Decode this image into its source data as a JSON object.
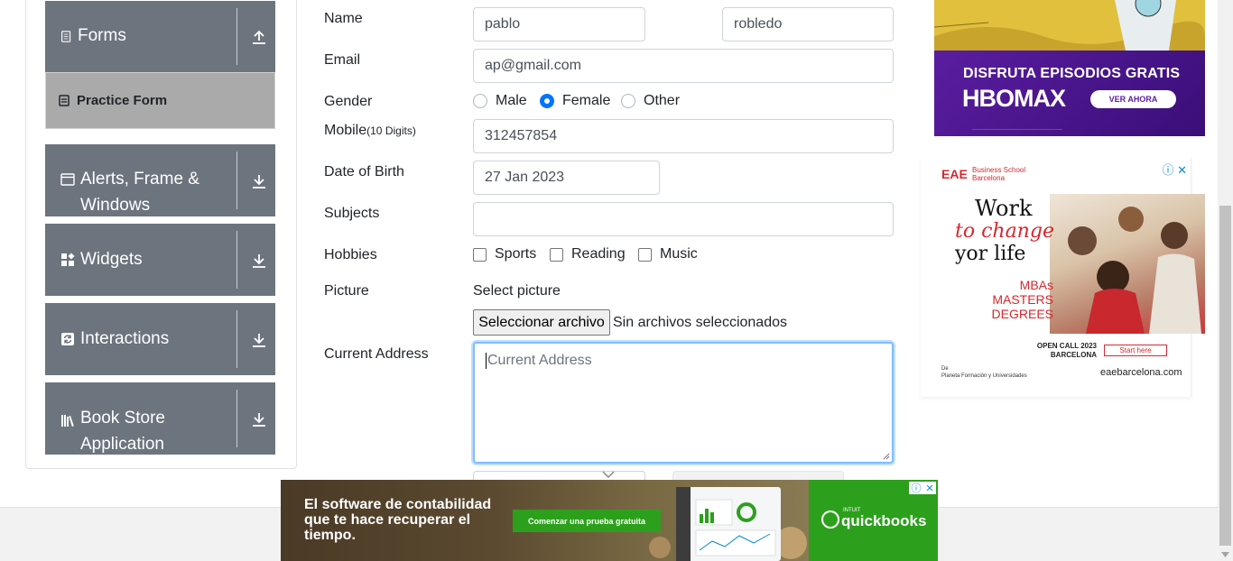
{
  "sidebar": {
    "groups": [
      {
        "label": "Forms",
        "icon": "document-icon",
        "arrow": "upload-arrow-icon"
      },
      {
        "label": "Alerts, Frame & Windows",
        "icon": "window-icon",
        "arrow": "download-arrow-icon"
      },
      {
        "label": "Widgets",
        "icon": "widgets-icon",
        "arrow": "download-arrow-icon"
      },
      {
        "label": "Interactions",
        "icon": "interactions-icon",
        "arrow": "download-arrow-icon"
      },
      {
        "label": "Book Store Application",
        "icon": "books-icon",
        "arrow": "download-arrow-icon"
      }
    ],
    "active_item": {
      "label": "Practice Form",
      "icon": "form-icon"
    }
  },
  "form": {
    "name_label": "Name",
    "first_name": "pablo",
    "last_name": "robledo",
    "email_label": "Email",
    "email": "ap@gmail.com",
    "gender_label": "Gender",
    "gender_options": [
      "Male",
      "Female",
      "Other"
    ],
    "gender_selected": "Female",
    "mobile_label": "Mobile",
    "mobile_hint": "(10 Digits)",
    "mobile": "312457854",
    "dob_label": "Date of Birth",
    "dob": "27 Jan 2023",
    "subjects_label": "Subjects",
    "subjects": "",
    "hobbies_label": "Hobbies",
    "hobbies": [
      "Sports",
      "Reading",
      "Music"
    ],
    "picture_label": "Picture",
    "picture_caption": "Select picture",
    "file_button": "Seleccionar archivo",
    "file_status": "Sin archivos seleccionados",
    "address_label": "Current Address",
    "address_placeholder": "Current Address"
  },
  "ads": {
    "hbo": {
      "headline": "DISFRUTA EPISODIOS GRATIS",
      "logo": "HBOMAX",
      "cta": "VER AHORA"
    },
    "eae": {
      "brand": "EAE",
      "brand_sub": "Business School Barcelona",
      "line1": "Work",
      "line2": "to change",
      "line3": "yor life",
      "programs": [
        "MBAs",
        "MASTERS",
        "DEGREES"
      ],
      "open_call": "OPEN CALL 2023 BARCELONA",
      "cta": "Start here",
      "by": "De",
      "owner": "Planeta Formación y Universidades",
      "url": "eaebarcelona.com"
    },
    "quickbooks": {
      "text": "El software de contabilidad que te hace recuperar el tiempo.",
      "cta": "Comenzar una prueba gratuita",
      "brand_small": "INTUIT",
      "brand": "quickbooks"
    }
  },
  "colors": {
    "sidebar_group": "#6c757d",
    "active_item": "#aaaaaa",
    "radio_accent": "#0075ff",
    "focus_border": "#80bdff"
  }
}
